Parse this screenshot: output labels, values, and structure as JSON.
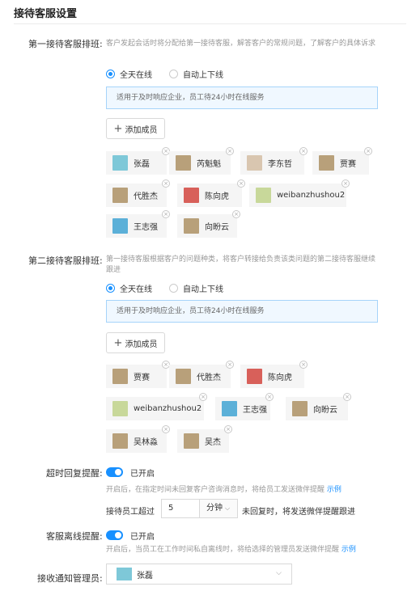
{
  "header": {
    "title": "接待客服设置"
  },
  "first": {
    "label": "第一接待客服排班:",
    "desc": "客户发起会话时将分配给第一接待客服，解答客户的常规问题，了解客户的具体诉求",
    "radio_on": "全天在线",
    "radio_off": "自动上下线",
    "info": "适用于及时响应企业，员工待24小时在线服务",
    "add_label": "添加成员",
    "members": [
      {
        "name": "张磊",
        "avatar": "cartoon-eyes-avatar"
      },
      {
        "name": "芮魁魁",
        "avatar": "photo-avatar"
      },
      {
        "name": "李东哲",
        "avatar": "cat-avatar"
      },
      {
        "name": "贾赛",
        "avatar": "photo-avatar"
      },
      {
        "name": "代胜杰",
        "avatar": "photo-avatar"
      },
      {
        "name": "陈向虎",
        "avatar": "red-avatar"
      },
      {
        "name": "weibanzhushou2",
        "avatar": "green-avatar"
      },
      {
        "name": "王志强",
        "avatar": "cartoon-boy-avatar"
      },
      {
        "name": "向盼云",
        "avatar": "photo-avatar"
      }
    ]
  },
  "second": {
    "label": "第二接待客服排班:",
    "desc": "第一接待客服根据客户的问题种类，将客户转接给负责该类问题的第二接待客服继续跟进",
    "radio_on": "全天在线",
    "radio_off": "自动上下线",
    "info": "适用于及时响应企业，员工待24小时在线服务",
    "add_label": "添加成员",
    "members": [
      {
        "name": "贾赛",
        "avatar": "photo-avatar"
      },
      {
        "name": "代胜杰",
        "avatar": "photo-avatar"
      },
      {
        "name": "陈向虎",
        "avatar": "red-avatar"
      },
      {
        "name": "weibanzhushou2",
        "avatar": "green-avatar"
      },
      {
        "name": "王志强",
        "avatar": "cartoon-boy-avatar"
      },
      {
        "name": "向盼云",
        "avatar": "photo-avatar"
      },
      {
        "name": "吴林淼",
        "avatar": "photo-avatar"
      },
      {
        "name": "吴杰",
        "avatar": "photo-avatar"
      }
    ]
  },
  "timeout": {
    "label": "超时回复提醒:",
    "state": "已开启",
    "note": "开启后，在指定时间未回复客户咨询消息时，将给员工发送微伴提醒",
    "link": "示例",
    "prefix": "接待员工超过",
    "value": "5",
    "unit": "分钟",
    "suffix": "未回复时，将发送微伴提醒跟进"
  },
  "offline": {
    "label": "客服离线提醒:",
    "state": "已开启",
    "note": "开启后，当员工在工作时间私自离线时，将给选择的管理员发送微伴提醒",
    "link": "示例"
  },
  "manager": {
    "label": "接收通知管理员:",
    "value": "张磊"
  },
  "colors": {
    "accent": "#1890ff",
    "info_bg": "#f0f8ff",
    "chip_bg": "#f5f5f5"
  }
}
